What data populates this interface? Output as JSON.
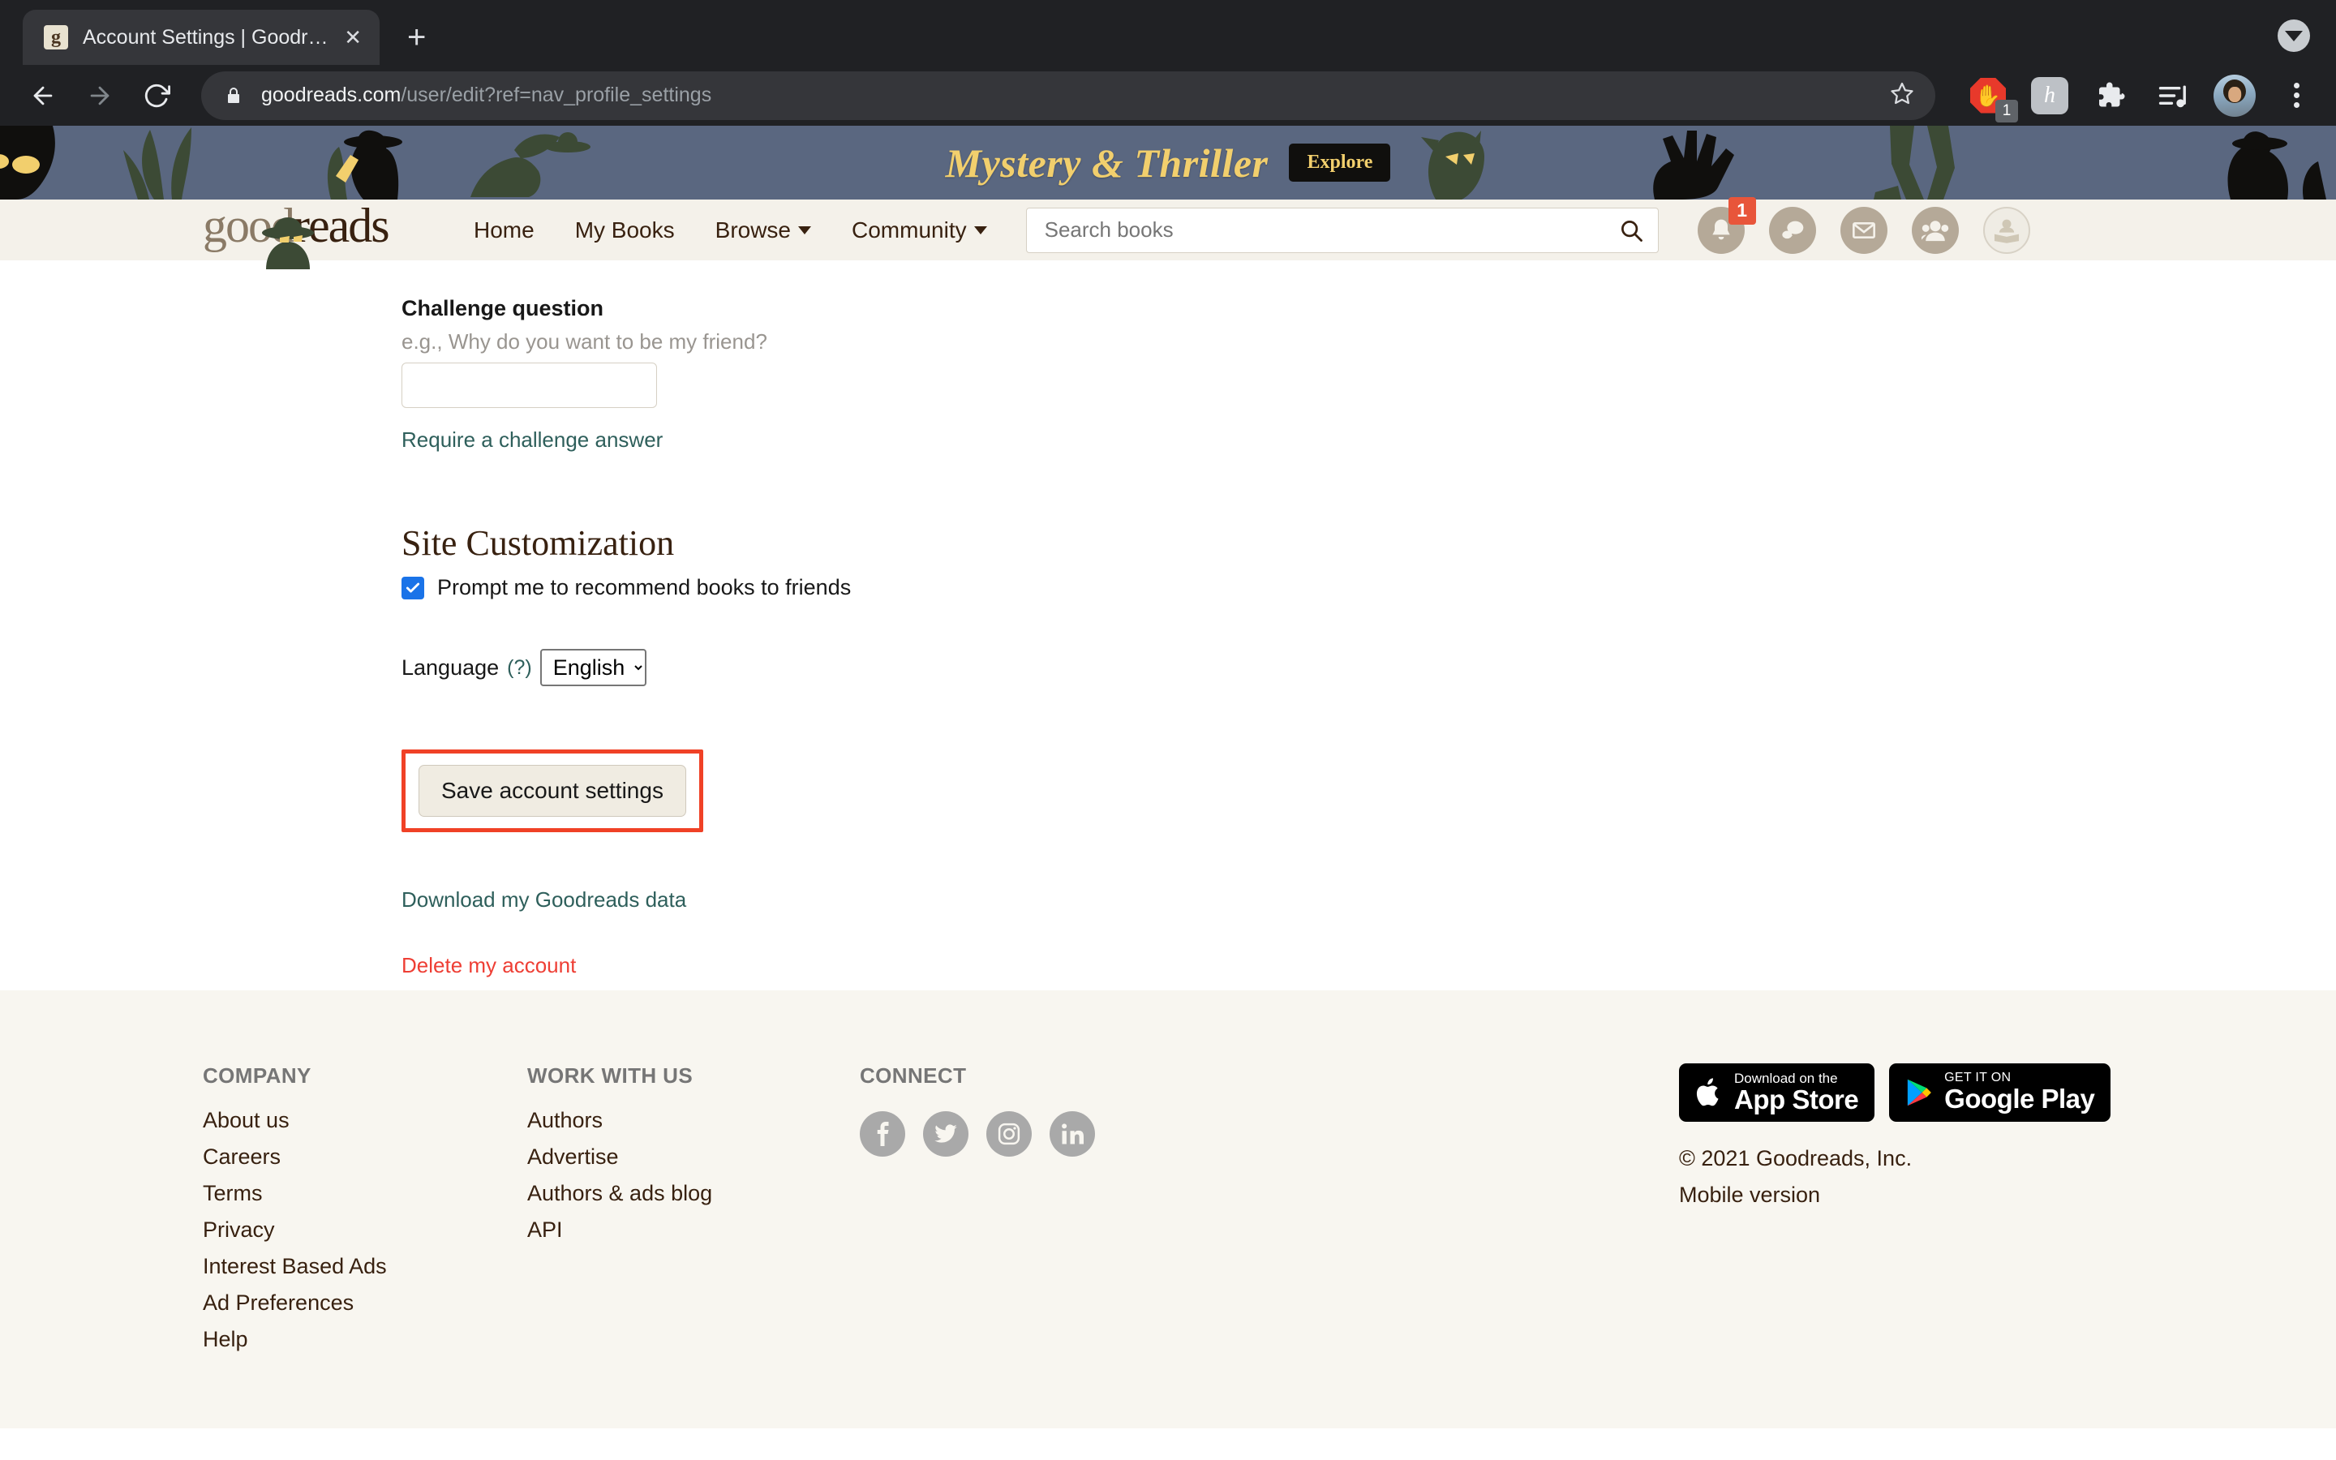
{
  "browser": {
    "tab": {
      "title": "Account Settings | Goodreads",
      "favicon": "g",
      "close_label": "✕"
    },
    "new_tab_label": "+",
    "window_control": "tab-search-chevron",
    "address": {
      "host": "goodreads.com",
      "path": "/user/edit?ref=nav_profile_settings"
    },
    "extensions": [
      {
        "name": "adblock-icon",
        "badge": "1"
      },
      {
        "name": "honey-icon",
        "glyph": "h"
      },
      {
        "name": "puzzle-extensions-icon"
      },
      {
        "name": "music-playlist-icon"
      },
      {
        "name": "browser-profile-avatar"
      },
      {
        "name": "chrome-menu-icon"
      }
    ]
  },
  "ad_banner": {
    "title": "Mystery & Thriller",
    "cta": "Explore",
    "background_color": "#5a6780",
    "title_color": "#f2cf6d"
  },
  "site_header": {
    "logo_text_good": "good",
    "logo_text_reads": "reads",
    "nav": [
      {
        "label": "Home",
        "has_caret": false
      },
      {
        "label": "My Books",
        "has_caret": false
      },
      {
        "label": "Browse",
        "has_caret": true
      },
      {
        "label": "Community",
        "has_caret": true
      }
    ],
    "search_placeholder": "Search books",
    "user_icons": [
      {
        "name": "notifications-bell-icon",
        "badge": "1"
      },
      {
        "name": "comments-icon",
        "badge": ""
      },
      {
        "name": "messages-envelope-icon",
        "badge": ""
      },
      {
        "name": "friends-group-icon",
        "badge": ""
      },
      {
        "name": "profile-avatar-icon",
        "badge": ""
      }
    ]
  },
  "main": {
    "challenge_question": {
      "label": "Challenge question",
      "hint": "e.g., Why do you want to be my friend?",
      "value": "",
      "require_link": "Require a challenge answer"
    },
    "site_customization": {
      "heading": "Site Customization",
      "recommend_checkbox_label": "Prompt me to recommend books to friends",
      "recommend_checked": true,
      "language_label": "Language",
      "language_help": "(?)",
      "language_value": "English",
      "language_options": [
        "English"
      ]
    },
    "save_button": "Save account settings",
    "highlight_color": "#f04126",
    "download_link": "Download my Goodreads data",
    "delete_link": "Delete my account"
  },
  "footer": {
    "company": {
      "heading": "COMPANY",
      "links": [
        "About us",
        "Careers",
        "Terms",
        "Privacy",
        "Interest Based Ads",
        "Ad Preferences",
        "Help"
      ]
    },
    "work": {
      "heading": "WORK WITH US",
      "links": [
        "Authors",
        "Advertise",
        "Authors & ads blog",
        "API"
      ]
    },
    "connect": {
      "heading": "CONNECT",
      "socials": [
        "facebook-icon",
        "twitter-icon",
        "instagram-icon",
        "linkedin-icon"
      ]
    },
    "app_store": {
      "small": "Download on the",
      "big": "App Store"
    },
    "google_play": {
      "small": "GET IT ON",
      "big": "Google Play"
    },
    "copyright": "© 2021 Goodreads, Inc.",
    "mobile_version": "Mobile version"
  }
}
